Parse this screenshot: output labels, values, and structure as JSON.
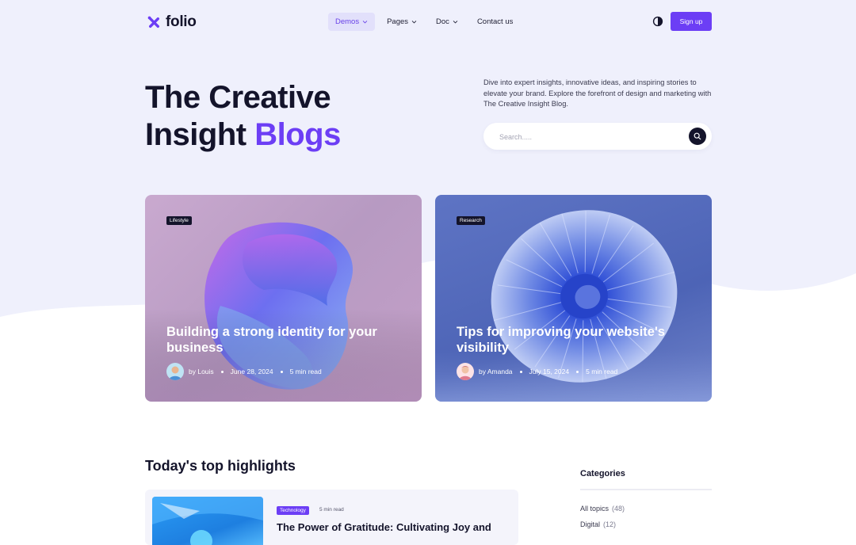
{
  "brand": {
    "name": "folio",
    "accent": "#6c3ef5"
  },
  "nav": {
    "items": [
      {
        "label": "Demos",
        "has_dropdown": true,
        "active": true
      },
      {
        "label": "Pages",
        "has_dropdown": true,
        "active": false
      },
      {
        "label": "Doc",
        "has_dropdown": true,
        "active": false
      },
      {
        "label": "Contact us",
        "has_dropdown": false,
        "active": false
      }
    ],
    "theme_toggle_icon": "contrast-icon",
    "signup_label": "Sign up"
  },
  "hero": {
    "title_line1": "The Creative",
    "title_line2_plain": "Insight ",
    "title_line2_accent": "Blogs",
    "description": "Dive into expert insights, innovative ideas, and inspiring stories to elevate your brand. Explore the forefront of design and marketing with The Creative Insight Blog.",
    "search_placeholder": "Search.....",
    "search_icon": "search-icon"
  },
  "featured": [
    {
      "tag": "Lifestyle",
      "title": "Building a strong identity for your business",
      "author": "by Louis",
      "date": "June 28, 2024",
      "read_time": "5 min read"
    },
    {
      "tag": "Research",
      "title": "Tips for improving your website's visibility",
      "author": "by Amanda",
      "date": "July 15, 2024",
      "read_time": "5 min read"
    }
  ],
  "highlights": {
    "heading": "Today's top highlights",
    "posts": [
      {
        "tag": "Technology",
        "read_time": "5 min read",
        "title": "The Power of Gratitude: Cultivating Joy and"
      }
    ]
  },
  "sidebar": {
    "categories_title": "Categories",
    "categories": [
      {
        "name": "All topics",
        "count": "(48)"
      },
      {
        "name": "Digital",
        "count": "(12)"
      }
    ]
  }
}
